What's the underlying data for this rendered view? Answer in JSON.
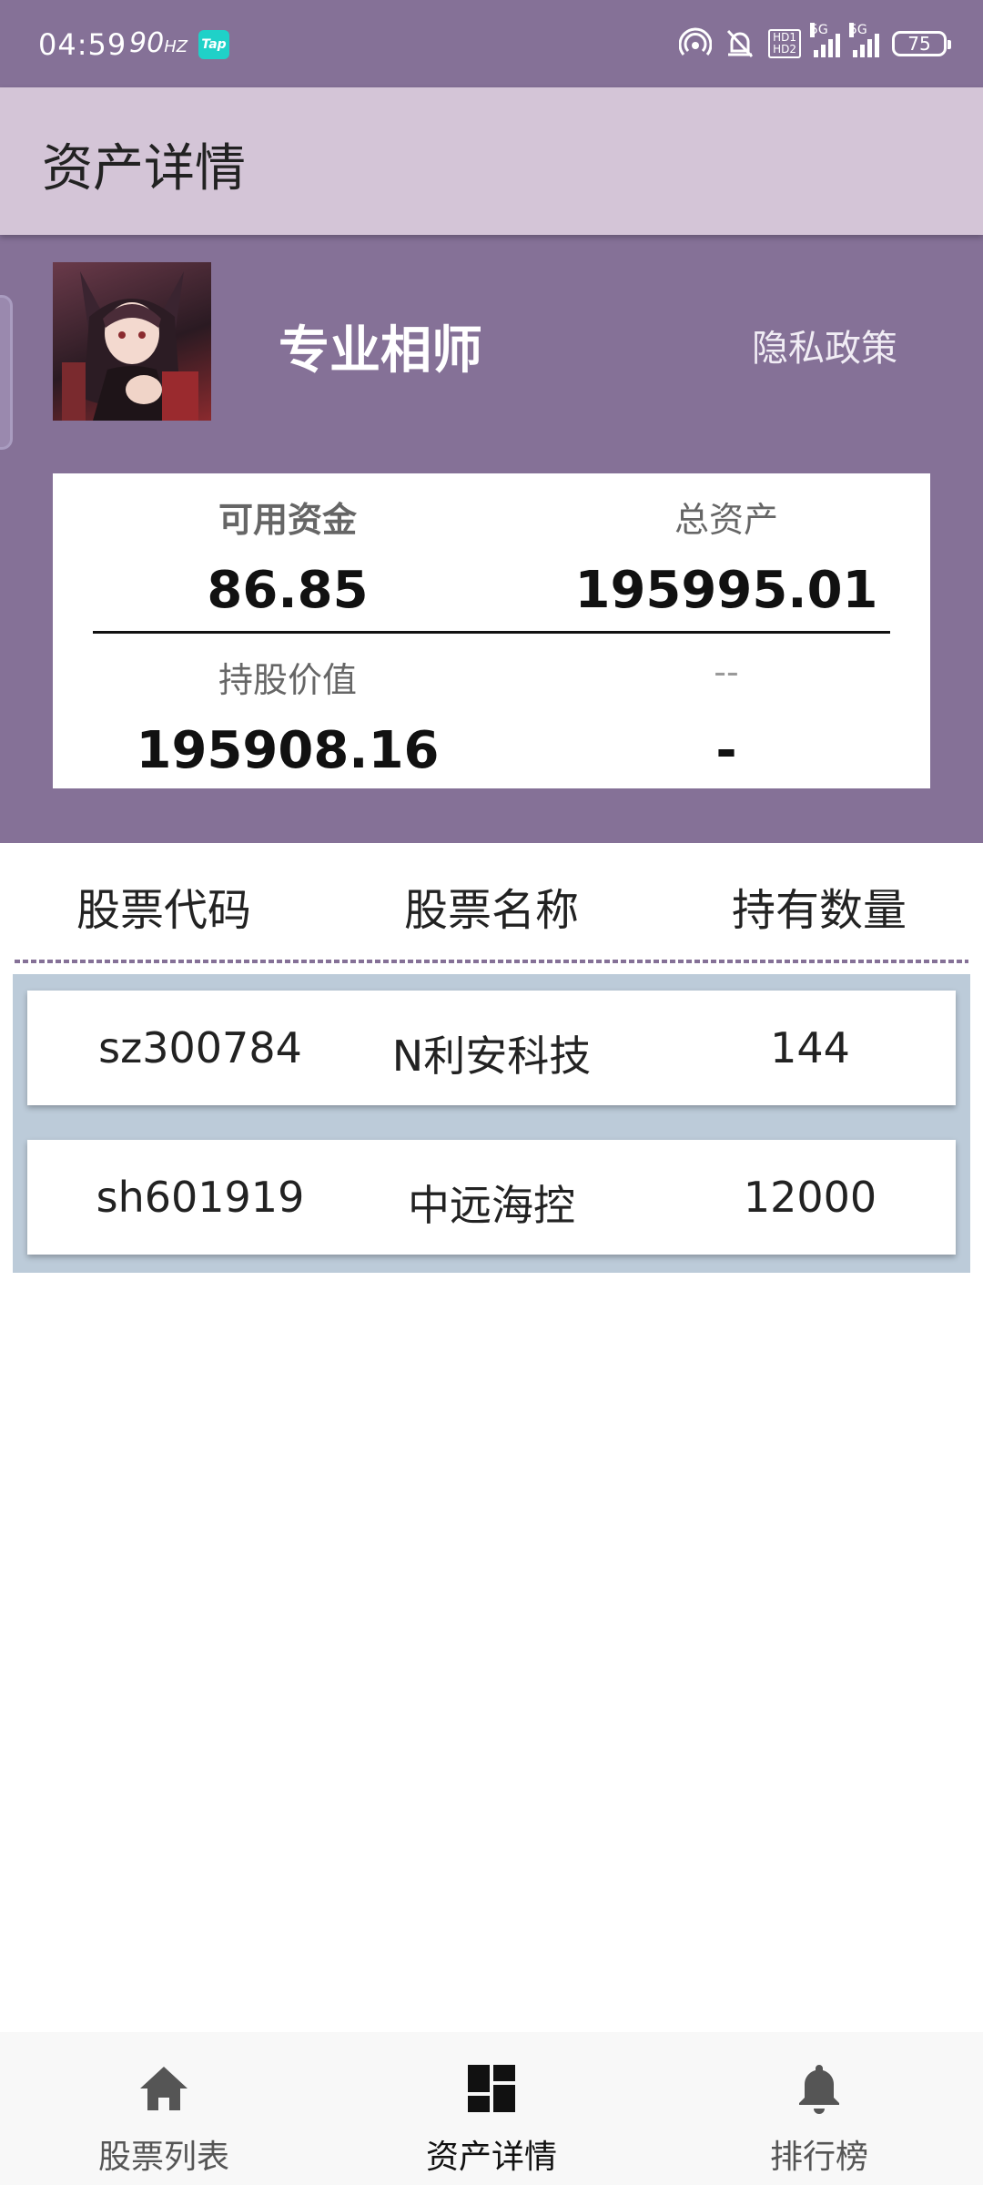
{
  "status_bar": {
    "time": "04:59",
    "refresh_rate": "90",
    "refresh_unit": "HZ",
    "app_badge": "Tap",
    "network": "5G",
    "battery": "75"
  },
  "header": {
    "title": "资产详情"
  },
  "profile": {
    "name": "专业相师",
    "privacy_link": "隐私政策"
  },
  "assets": {
    "available_funds_label": "可用资金",
    "available_funds": "86.85",
    "total_assets_label": "总资产",
    "total_assets": "195995.01",
    "holding_value_label": "持股价值",
    "holding_value": "195908.16",
    "extra_label": "--",
    "extra_value": "-"
  },
  "table": {
    "columns": [
      "股票代码",
      "股票名称",
      "持有数量"
    ],
    "rows": [
      {
        "code": "sz300784",
        "name": "N利安科技",
        "quantity": "144"
      },
      {
        "code": "sh601919",
        "name": "中远海控",
        "quantity": "12000"
      }
    ]
  },
  "bottom_nav": {
    "items": [
      {
        "label": "股票列表",
        "icon": "home-icon"
      },
      {
        "label": "资产详情",
        "icon": "dashboard-icon"
      },
      {
        "label": "排行榜",
        "icon": "bell-icon"
      }
    ],
    "active_index": 1
  },
  "colors": {
    "primary": "#857197",
    "header_bg": "#d4c5d7",
    "list_bg": "#bccbd9",
    "nav_active": "#111111",
    "nav_inactive": "#555555"
  }
}
